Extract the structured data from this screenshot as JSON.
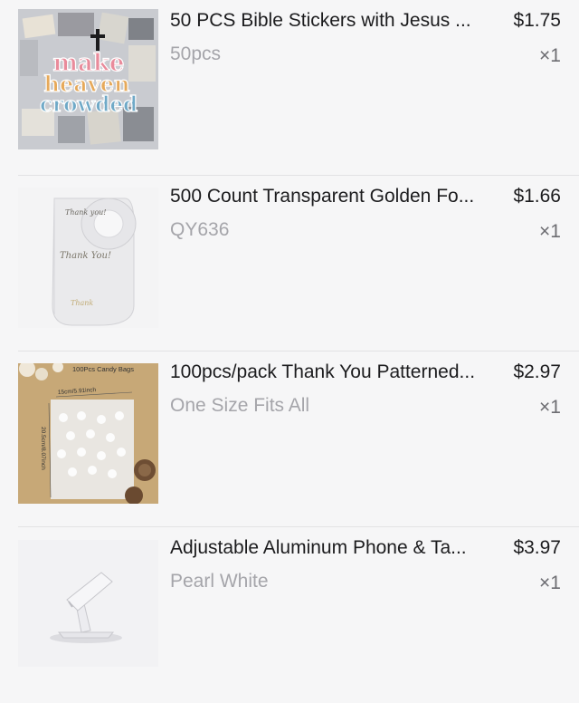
{
  "items": [
    {
      "title": "50 PCS Bible Stickers with Jesus ...",
      "price": "$1.75",
      "variant": "50pcs",
      "qty": "×1",
      "thumb": {
        "lines": [
          "make",
          "heaven",
          "crowded"
        ],
        "colors": [
          "#e98b9b",
          "#e6a95a",
          "#6fa9c7"
        ]
      }
    },
    {
      "title": "500 Count Transparent Golden Fo...",
      "price": "$1.66",
      "variant": "QY636",
      "qty": "×1",
      "thumb": {
        "text_top": "Thank you!",
        "text_mid": "Thank You!",
        "text_low": "Thank"
      }
    },
    {
      "title": "100pcs/pack Thank You Patterned...",
      "price": "$2.97",
      "variant": "One Size Fits All",
      "qty": "×1",
      "thumb": {
        "label": "100Pcs Candy Bags",
        "width_label": "15cm/5.91inch",
        "height_label": "20.5cm/8.07inch"
      }
    },
    {
      "title": "Adjustable Aluminum Phone & Ta...",
      "price": "$3.97",
      "variant": "Pearl White",
      "qty": "×1"
    }
  ]
}
